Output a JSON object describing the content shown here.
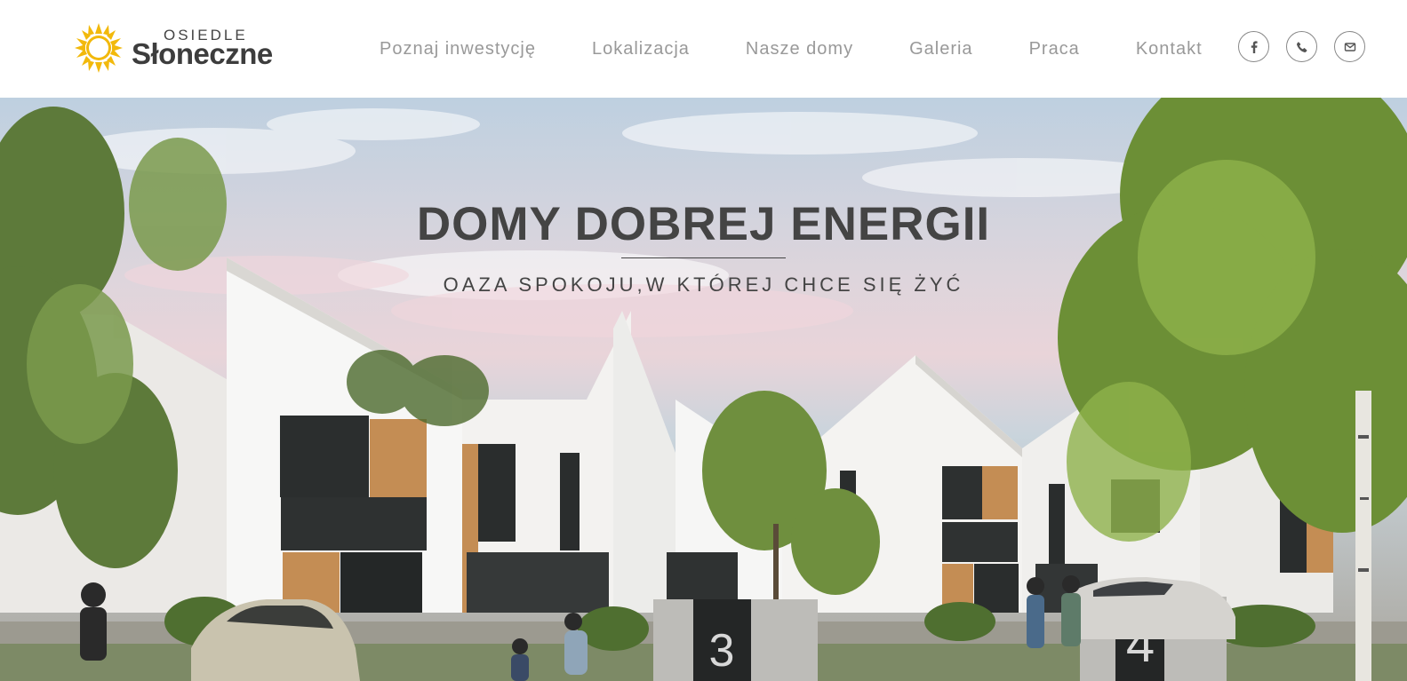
{
  "logo": {
    "top_text": "OSIEDLE",
    "main_text": "Słoneczne",
    "icon": "sun-flower-icon",
    "color": "#f2b90c"
  },
  "nav": {
    "items": [
      "Poznaj inwestycję",
      "Lokalizacja",
      "Nasze domy",
      "Galeria",
      "Praca",
      "Kontakt"
    ]
  },
  "social": {
    "icons": [
      "facebook-icon",
      "phone-icon",
      "mail-icon"
    ]
  },
  "hero": {
    "title": "DOMY DOBREJ ENERGII",
    "subtitle": "OAZA SPOKOJU,W KTÓREJ CHCE SIĘ ŻYĆ",
    "plates": [
      "3",
      "4"
    ]
  },
  "colors": {
    "text_dark": "#444444",
    "nav_text": "#999999",
    "accent": "#f2b90c"
  }
}
